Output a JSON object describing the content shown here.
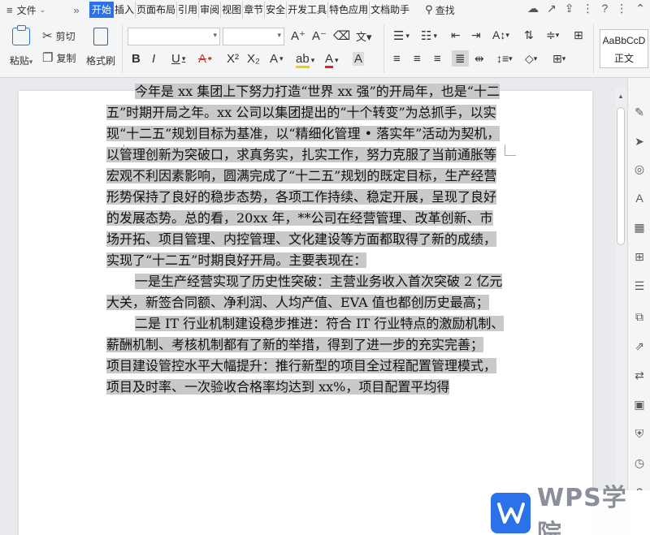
{
  "menubar": {
    "file_label": "文件",
    "tabs": [
      "开始",
      "插入",
      "页面布局",
      "引用",
      "审阅",
      "视图",
      "章节",
      "安全",
      "开发工具",
      "特色应用",
      "文档助手"
    ],
    "search_label": "查找"
  },
  "ribbon": {
    "paste": "粘贴",
    "cut": "剪切",
    "copy": "复制",
    "format_painter": "格式刷",
    "font_name": "",
    "font_size": "",
    "style_preview": "AaBbCcD",
    "style_name": "正文"
  },
  "document": {
    "paragraphs": [
      {
        "indent": true,
        "text": "今年是 xx 集团上下努力打造“世界 xx 强”的开局年，也是“十二五”时期开局之年。xx 公司以集团提出的“十个转变”为总抓手，以实现“十二五”规划目标为基准，以“精细化管理 • 落实年”活动为契机，以管理创新为突破口，求真务实，扎实工作，努力克服了当前通胀等宏观不利因素影响，圆满完成了“十二五”规划的既定目标，生产经营形势保持了良好的稳步态势，各项工作持续、稳定开展，呈现了良好的发展态势。总的看，20xx 年，**公司在经营管理、改革创新、市场开拓、项目管理、内控管理、文化建设等方面都取得了新的成绩，实现了“十二五”时期良好开局。主要表现在："
      },
      {
        "indent": true,
        "text": "一是生产经营实现了历史性突破：主营业务收入首次突破 2 亿元大关，新签合同额、净利润、人均产值、EVA 值也都创历史最高；"
      },
      {
        "indent": true,
        "text": "二是 IT 行业机制建设稳步推进：符合 IT 行业特点的激励机制、薪酬机制、考核机制都有了新的举措，得到了进一步的充实完善；"
      },
      {
        "indent": false,
        "text": "项目建设管控水平大幅提升：推行新型的项目全过程配置管理模式，项目及时率、一次验收合格率均达到 xx%，项目配置平均得"
      }
    ]
  },
  "watermark": {
    "text": "WPS学院"
  }
}
